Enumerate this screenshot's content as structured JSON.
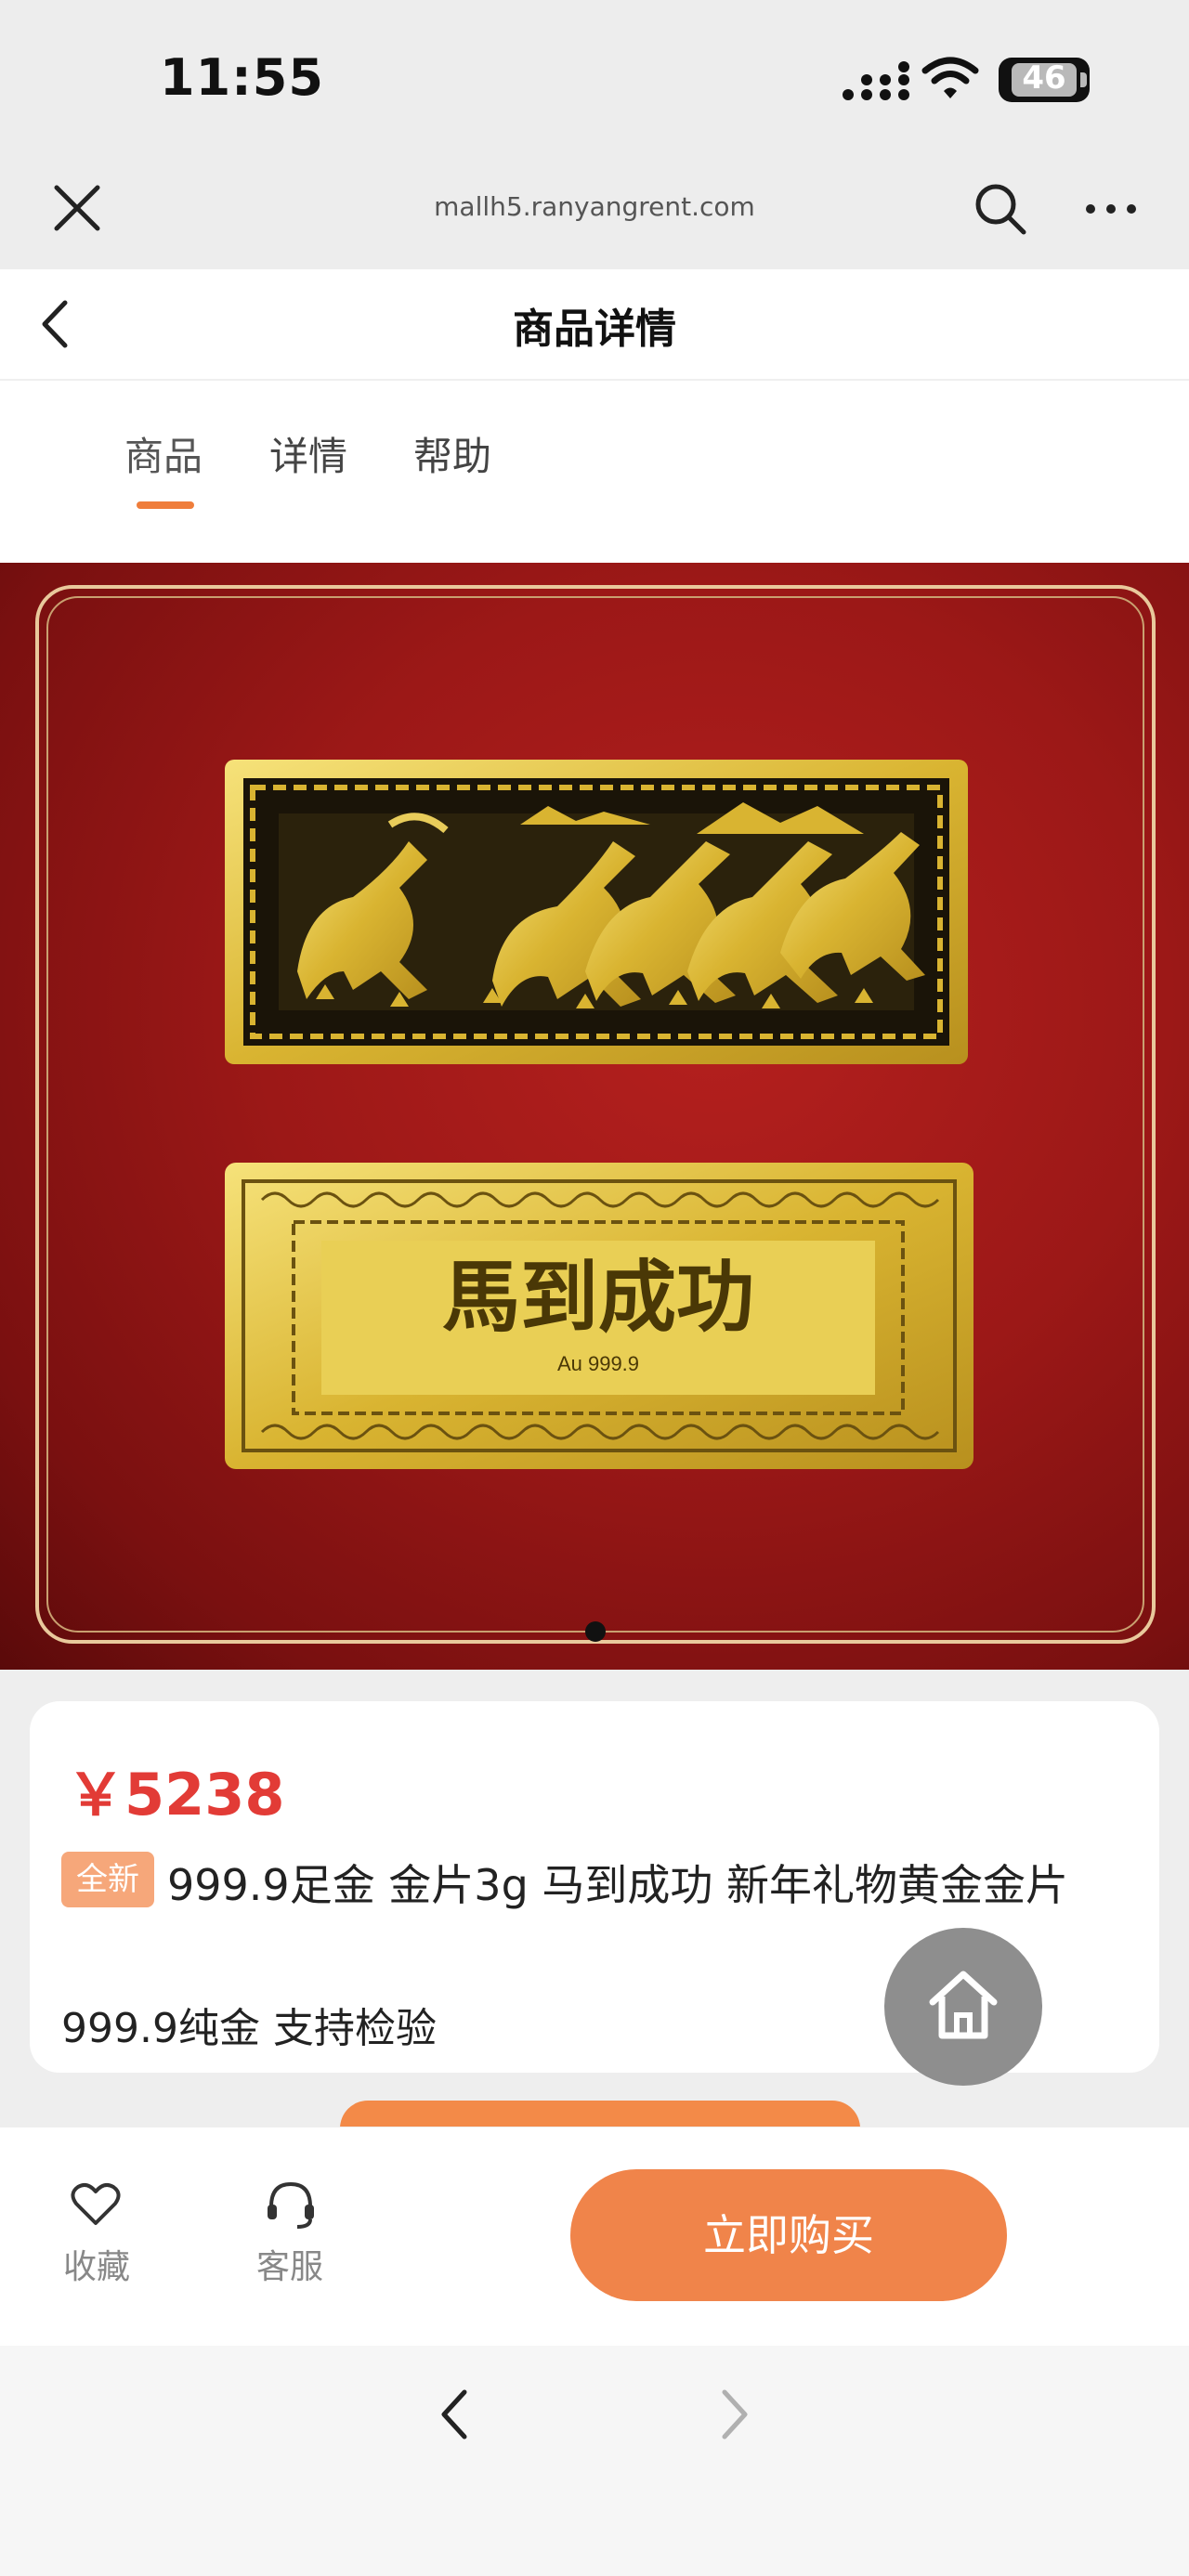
{
  "status_bar": {
    "time": "11:55",
    "battery": "46",
    "icons": [
      "signal-icon",
      "wifi-icon",
      "battery-icon"
    ]
  },
  "browser": {
    "url": "mallh5.ranyangrent.com",
    "icons": [
      "close-icon",
      "search-icon",
      "more-icon"
    ]
  },
  "header": {
    "title": "商品详情",
    "icons": [
      "back-icon"
    ]
  },
  "tabs": [
    {
      "label": "商品",
      "active": true
    },
    {
      "label": "详情",
      "active": false
    },
    {
      "label": "帮助",
      "active": false
    }
  ],
  "colors": {
    "accent": "#ef7d3b",
    "price": "#e23b36",
    "badge": "#f6a77a",
    "hero_bg": "#9c1817",
    "gold": "#d9b431"
  },
  "hero": {
    "bar2_text": "馬到成功",
    "bar2_purity": "Au 999.9",
    "slide_count": 1,
    "active_slide": 1
  },
  "product": {
    "price": "￥5238",
    "badge": "全新",
    "title": "999.9足金 金片3g 马到成功 新年礼物黄金金片",
    "subtitle": "999.9纯金 支持检验"
  },
  "float_button": {
    "icon": "home-icon"
  },
  "action_bar": {
    "favorite_label": "收藏",
    "service_label": "客服",
    "buy_label": "立即购买",
    "icons": [
      "heart-icon",
      "headset-icon"
    ]
  },
  "browser_nav": {
    "icons": [
      "nav-back-icon",
      "nav-forward-icon"
    ],
    "forward_enabled": false
  }
}
